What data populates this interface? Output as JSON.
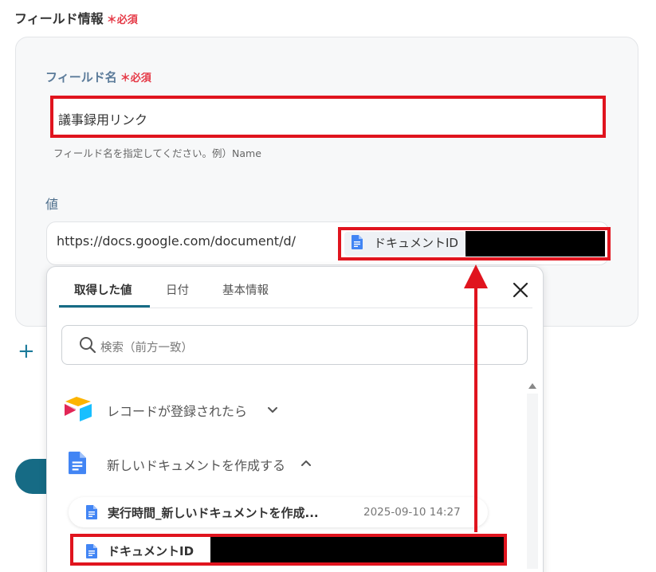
{
  "section": {
    "title": "フィールド情報",
    "required_mark": "＊",
    "required_text": "必須"
  },
  "field_name": {
    "label": "フィールド名",
    "required_mark": "＊",
    "required_text": "必須",
    "value": "議事録用リンク",
    "hint": "フィールド名を指定してください。例）Name"
  },
  "value_field": {
    "label": "値",
    "url_text": "https://docs.google.com/document/d/",
    "chip_label": "ドキュメントID"
  },
  "add_icon": "+",
  "picker": {
    "tabs": [
      "取得した値",
      "日付",
      "基本情報"
    ],
    "active_tab": "取得した値",
    "search_placeholder": "検索（前方一致）",
    "groups": [
      {
        "label": "レコードが登録されたら",
        "icon": "airtable-icon",
        "expanded": false
      },
      {
        "label": "新しいドキュメントを作成する",
        "icon": "google-docs-icon",
        "expanded": true
      }
    ],
    "items": [
      {
        "label": "実行時間_新しいドキュメントを作成...",
        "time": "2025-09-10 14:27",
        "icon": "google-docs-icon"
      },
      {
        "label": "ドキュメントID",
        "icon": "google-docs-icon"
      }
    ]
  },
  "colors": {
    "accent": "#166b85",
    "required": "#e53946",
    "highlight": "#e0141e",
    "docs_blue": "#4285f4"
  }
}
